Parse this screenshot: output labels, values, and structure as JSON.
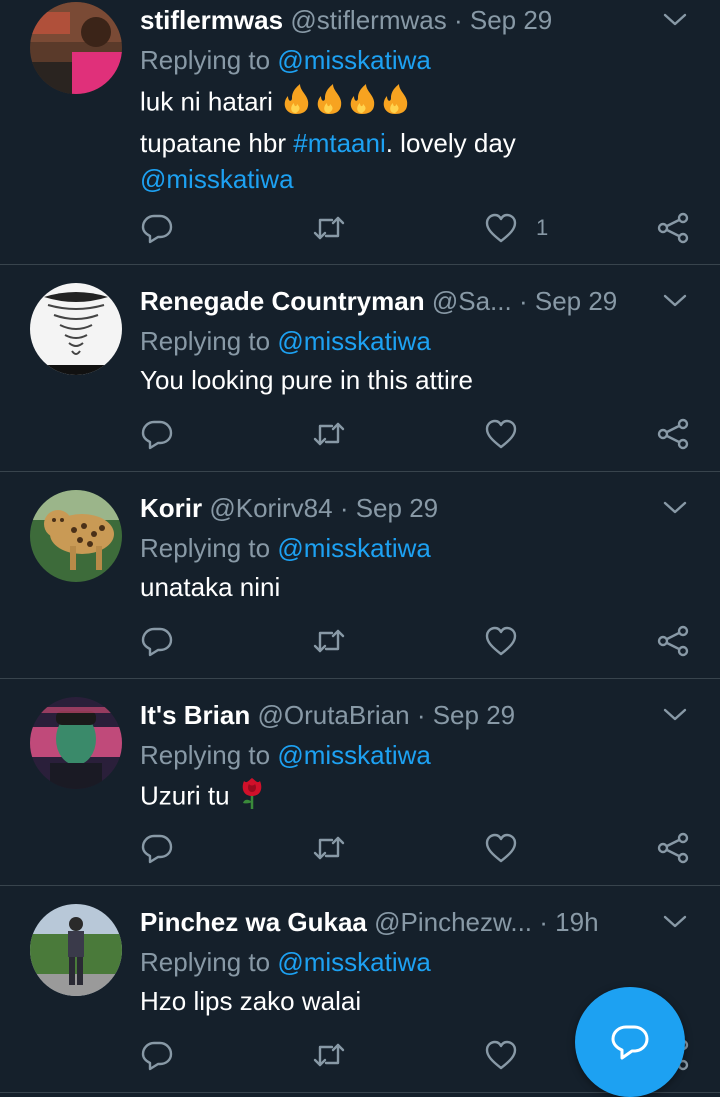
{
  "tweets": [
    {
      "name": "stiflermwas",
      "handle": "@stiflermwas",
      "dot": "·",
      "time": "Sep 29",
      "replying_prefix": "Replying to",
      "replying_to": "@misskatiwa",
      "line1_text": "luk ni hatari ",
      "line2_pre": "tupatane hbr ",
      "line2_hashtag": "#mtaani",
      "line2_post": ". lovely day",
      "line3_mention": "@misskatiwa",
      "like_count": "1",
      "avatar_icon": "avatar-photo-man-red-shirt"
    },
    {
      "name": "Renegade Countryman",
      "handle": "@Sa...",
      "dot": "·",
      "time": "Sep 29",
      "replying_prefix": "Replying to",
      "replying_to": "@misskatiwa",
      "text": "You looking pure in this attire",
      "avatar_icon": "avatar-tornado"
    },
    {
      "name": "Korir",
      "handle": "@Korirv84",
      "dot": "·",
      "time": "Sep 29",
      "replying_prefix": "Replying to",
      "replying_to": "@misskatiwa",
      "text": "unataka nini",
      "avatar_icon": "avatar-leopard"
    },
    {
      "name": "It's Brian",
      "handle": "@OrutaBrian",
      "dot": "·",
      "time": "Sep 29",
      "replying_prefix": "Replying to",
      "replying_to": "@misskatiwa",
      "text": "Uzuri tu ",
      "avatar_icon": "avatar-man-neon"
    },
    {
      "name": "Pinchez wa Gukaa",
      "handle": "@Pinchezw...",
      "dot": "·",
      "time": "19h",
      "replying_prefix": "Replying to",
      "replying_to": "@misskatiwa",
      "text": "Hzo lips zako walai",
      "avatar_icon": "avatar-person-standing"
    }
  ],
  "colors": {
    "background": "#15202b",
    "divider": "#38444d",
    "secondary_text": "#8899a6",
    "accent": "#1da1f2",
    "primary_text": "#ffffff"
  },
  "icons": {
    "reply": "reply-icon",
    "retweet": "retweet-icon",
    "like": "heart-icon",
    "share": "share-icon",
    "caret": "chevron-down-icon",
    "compose": "compose-reply-icon"
  }
}
